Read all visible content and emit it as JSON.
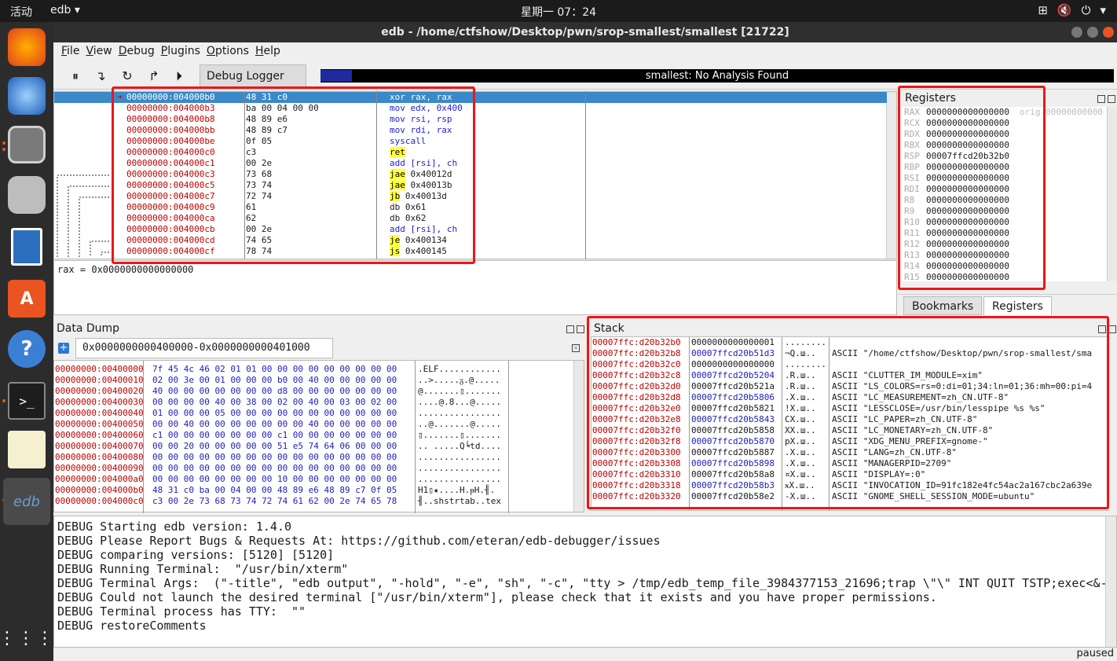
{
  "topbar": {
    "activities": "活动",
    "app": "edb ▾",
    "clock": "星期一 07：24",
    "tray": [
      "⊞",
      "🔇",
      "⏻",
      "▾"
    ]
  },
  "window": {
    "title": "edb - /home/ctfshow/Desktop/pwn/srop-smallest/smallest [21722]"
  },
  "menu": [
    "File",
    "View",
    "Debug",
    "Plugins",
    "Options",
    "Help"
  ],
  "toolbar": {
    "debug_logger_tab": "Debug Logger",
    "status": "smallest: No Analysis Found",
    "progress": 0.04
  },
  "disasm": [
    {
      "addr": "00000000:004000b0",
      "bytes": "48 31 c0",
      "ins": "xor rax, rax",
      "jmp": false
    },
    {
      "addr": "00000000:004000b3",
      "bytes": "ba 00 04 00 00",
      "ins": "mov edx, 0x400",
      "jmp": false
    },
    {
      "addr": "00000000:004000b8",
      "bytes": "48 89 e6",
      "ins": "mov rsi, rsp",
      "jmp": false
    },
    {
      "addr": "00000000:004000bb",
      "bytes": "48 89 c7",
      "ins": "mov rdi, rax",
      "jmp": false
    },
    {
      "addr": "00000000:004000be",
      "bytes": "0f 05",
      "ins": "syscall",
      "jmp": false
    },
    {
      "addr": "00000000:004000c0",
      "bytes": "c3",
      "ins": "ret",
      "jmp": true,
      "op": ""
    },
    {
      "addr": "00000000:004000c1",
      "bytes": "00 2e",
      "ins": "add [rsi], ch",
      "jmp": false
    },
    {
      "addr": "00000000:004000c3",
      "bytes": "73 68",
      "ins": "jae",
      "op": " 0x40012d",
      "jmp": true
    },
    {
      "addr": "00000000:004000c5",
      "bytes": "73 74",
      "ins": "jae",
      "op": " 0x40013b",
      "jmp": true
    },
    {
      "addr": "00000000:004000c7",
      "bytes": "72 74",
      "ins": "jb",
      "op": " 0x40013d",
      "jmp": true
    },
    {
      "addr": "00000000:004000c9",
      "bytes": "61",
      "ins": "db 0x61",
      "jmp": false,
      "plain": true
    },
    {
      "addr": "00000000:004000ca",
      "bytes": "62",
      "ins": "db 0x62",
      "jmp": false,
      "plain": true
    },
    {
      "addr": "00000000:004000cb",
      "bytes": "00 2e",
      "ins": "add [rsi], ch",
      "jmp": false
    },
    {
      "addr": "00000000:004000cd",
      "bytes": "74 65",
      "ins": "je",
      "op": " 0x400134",
      "jmp": true
    },
    {
      "addr": "00000000:004000cf",
      "bytes": "78 74",
      "ins": "js",
      "op": " 0x400145",
      "jmp": true
    }
  ],
  "rax_line": "rax = 0x0000000000000000",
  "registers": {
    "title": "Registers",
    "orig_label": "orig",
    "orig_value": "00000000000",
    "list": [
      {
        "n": "RAX",
        "v": "0000000000000000"
      },
      {
        "n": "RCX",
        "v": "0000000000000000"
      },
      {
        "n": "RDX",
        "v": "0000000000000000"
      },
      {
        "n": "RBX",
        "v": "0000000000000000"
      },
      {
        "n": "RSP",
        "v": "00007ffcd20b32b0"
      },
      {
        "n": "RBP",
        "v": "0000000000000000"
      },
      {
        "n": "RSI",
        "v": "0000000000000000"
      },
      {
        "n": "RDI",
        "v": "0000000000000000"
      },
      {
        "n": "R8",
        "v": "0000000000000000"
      },
      {
        "n": "R9",
        "v": "0000000000000000"
      },
      {
        "n": "R10",
        "v": "0000000000000000"
      },
      {
        "n": "R11",
        "v": "0000000000000000"
      },
      {
        "n": "R12",
        "v": "0000000000000000"
      },
      {
        "n": "R13",
        "v": "0000000000000000"
      },
      {
        "n": "R14",
        "v": "0000000000000000"
      },
      {
        "n": "R15",
        "v": "0000000000000000"
      }
    ]
  },
  "bottom_tabs": [
    "Bookmarks",
    "Registers"
  ],
  "data_dump": {
    "title": "Data Dump",
    "range": "0x0000000000400000-0x0000000000401000",
    "rows": [
      {
        "a": "00000000:00400000",
        "h": "7f 45 4c 46 02 01 01 00 00 00 00 00 00 00 00 00",
        "t": ".ELF............"
      },
      {
        "a": "00000000:00400010",
        "h": "02 00 3e 00 01 00 00 00 b0 00 40 00 00 00 00 00",
        "t": "..>.....ᵹ.@....."
      },
      {
        "a": "00000000:00400020",
        "h": "40 00 00 00 00 00 00 00 d8 00 00 00 00 00 00 00",
        "t": "@.......▯......."
      },
      {
        "a": "00000000:00400030",
        "h": "00 00 00 00 40 00 38 00 02 00 40 00 03 00 02 00",
        "t": "....@.8...@....."
      },
      {
        "a": "00000000:00400040",
        "h": "01 00 00 00 05 00 00 00 00 00 00 00 00 00 00 00",
        "t": "................"
      },
      {
        "a": "00000000:00400050",
        "h": "00 00 40 00 00 00 00 00 00 00 40 00 00 00 00 00",
        "t": "..@.......@....."
      },
      {
        "a": "00000000:00400060",
        "h": "c1 00 00 00 00 00 00 00 c1 00 00 00 00 00 00 00",
        "t": "▯.......▯......."
      },
      {
        "a": "00000000:00400070",
        "h": "00 00 20 00 00 00 00 00 51 e5 74 64 06 00 00 00",
        "t": ".. .....Q╘td...."
      },
      {
        "a": "00000000:00400080",
        "h": "00 00 00 00 00 00 00 00 00 00 00 00 00 00 00 00",
        "t": "................"
      },
      {
        "a": "00000000:00400090",
        "h": "00 00 00 00 00 00 00 00 00 00 00 00 00 00 00 00",
        "t": "................"
      },
      {
        "a": "00000000:004000a0",
        "h": "00 00 00 00 00 00 00 00 10 00 00 00 00 00 00 00",
        "t": "................"
      },
      {
        "a": "00000000:004000b0",
        "h": "48 31 c0 ba 00 04 00 00 48 89 e6 48 89 c7 0f 05",
        "t": "H1▯★....H.ᵽH.╢."
      },
      {
        "a": "00000000:004000c0",
        "h": "c3 00 2e 73 68 73 74 72 74 61 62 00 2e 74 65 78",
        "t": "╢..shstrtab..tex"
      }
    ]
  },
  "stack": {
    "title": "Stack",
    "rows": [
      {
        "a": "00007ffc:d20b32b0",
        "v": "0000000000000001",
        "c": "........",
        "s": ""
      },
      {
        "a": "00007ffc:d20b32b8",
        "v": "00007ffcd20b51d3",
        "c": "¬Q.ш..",
        "s": "ASCII \"/home/ctfshow/Desktop/pwn/srop-smallest/sma"
      },
      {
        "a": "00007ffc:d20b32c0",
        "v": "0000000000000000",
        "c": "........",
        "s": ""
      },
      {
        "a": "00007ffc:d20b32c8",
        "v": "00007ffcd20b5204",
        "c": ".R.ш..",
        "s": "ASCII \"CLUTTER_IM_MODULE=xim\""
      },
      {
        "a": "00007ffc:d20b32d0",
        "v": "00007ffcd20b521a",
        "c": ".R.ш..",
        "s": "ASCII \"LS_COLORS=rs=0:di=01;34:ln=01;36:mh=00:pi=4"
      },
      {
        "a": "00007ffc:d20b32d8",
        "v": "00007ffcd20b5806",
        "c": ".X.ш..",
        "s": "ASCII \"LC_MEASUREMENT=zh_CN.UTF-8\""
      },
      {
        "a": "00007ffc:d20b32e0",
        "v": "00007ffcd20b5821",
        "c": "!X.ш..",
        "s": "ASCII \"LESSCLOSE=/usr/bin/lesspipe %s %s\""
      },
      {
        "a": "00007ffc:d20b32e8",
        "v": "00007ffcd20b5843",
        "c": "CX.ш..",
        "s": "ASCII \"LC_PAPER=zh_CN.UTF-8\""
      },
      {
        "a": "00007ffc:d20b32f0",
        "v": "00007ffcd20b5858",
        "c": "XX.ш..",
        "s": "ASCII \"LC_MONETARY=zh_CN.UTF-8\""
      },
      {
        "a": "00007ffc:d20b32f8",
        "v": "00007ffcd20b5870",
        "c": "pX.ш..",
        "s": "ASCII \"XDG_MENU_PREFIX=gnome-\""
      },
      {
        "a": "00007ffc:d20b3300",
        "v": "00007ffcd20b5887",
        "c": ".X.ш..",
        "s": "ASCII \"LANG=zh_CN.UTF-8\""
      },
      {
        "a": "00007ffc:d20b3308",
        "v": "00007ffcd20b5898",
        "c": ".X.ш..",
        "s": "ASCII \"MANAGERPID=2709\""
      },
      {
        "a": "00007ffc:d20b3310",
        "v": "00007ffcd20b58a8",
        "c": "¤X.ш..",
        "s": "ASCII \"DISPLAY=:0\""
      },
      {
        "a": "00007ffc:d20b3318",
        "v": "00007ffcd20b58b3",
        "c": "ӿX.ш..",
        "s": "ASCII \"INVOCATION_ID=91fc182e4fc54ac2a167cbc2a639e"
      },
      {
        "a": "00007ffc:d20b3320",
        "v": "00007ffcd20b58e2",
        "c": "-X.ш..",
        "s": "ASCII \"GNOME_SHELL_SESSION_MODE=ubuntu\""
      }
    ]
  },
  "log": [
    "DEBUG Starting edb version: 1.4.0",
    "DEBUG Please Report Bugs & Requests At: https://github.com/eteran/edb-debugger/issues",
    "DEBUG comparing versions: [5120] [5120]",
    "DEBUG Running Terminal:  \"/usr/bin/xterm\"",
    "DEBUG Terminal Args:  (\"-title\", \"edb output\", \"-hold\", \"-e\", \"sh\", \"-c\", \"tty > /tmp/edb_temp_file_3984377153_21696;trap \\\"\\\" INT QUIT TSTP;exec<&-",
    "DEBUG Could not launch the desired terminal [\"/usr/bin/xterm\"], please check that it exists and you have proper permissions.",
    "DEBUG Terminal process has TTY:  \"\"",
    "DEBUG restoreComments"
  ],
  "status_text": "paused",
  "colors": {
    "highlight": "#3a89c9",
    "address": "#c00000",
    "mnemonic": "#2020e0",
    "jump_bg": "#ffff40",
    "annotation": "#f01515"
  }
}
